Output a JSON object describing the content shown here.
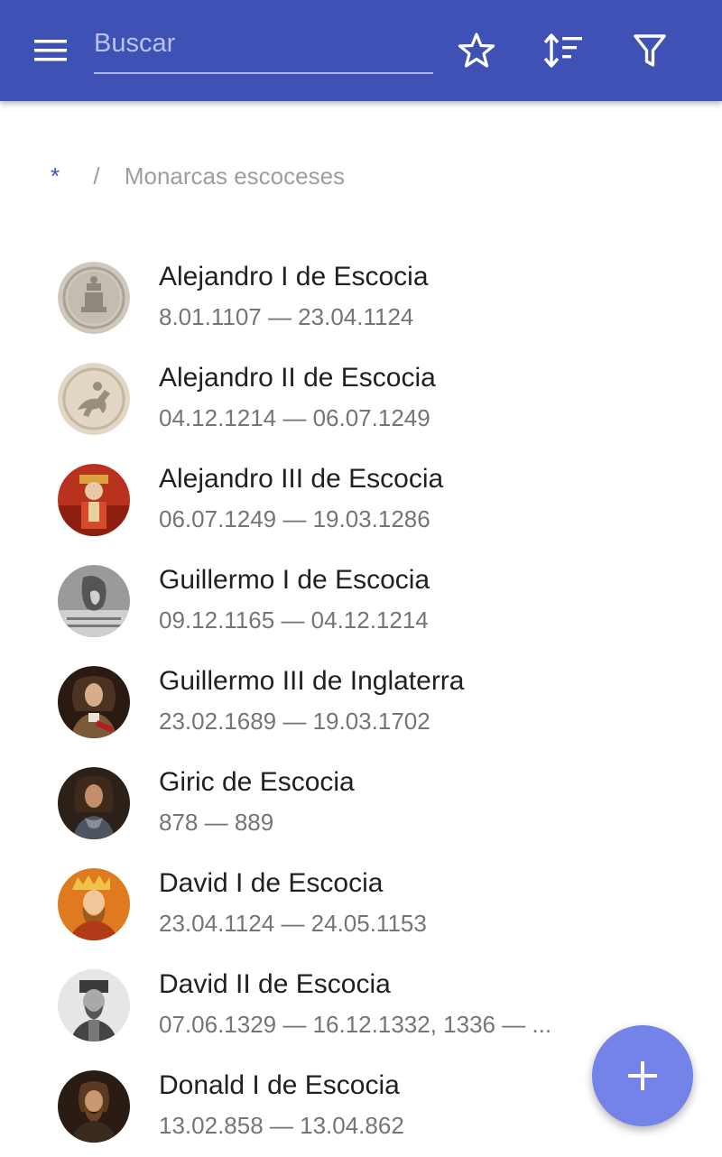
{
  "appbar": {
    "search_placeholder": "Buscar",
    "icons": [
      "menu-icon",
      "star-icon",
      "sort-icon",
      "filter-icon"
    ],
    "accent_color": "#3f51b5"
  },
  "breadcrumb": {
    "root": "*",
    "separator": "/",
    "current": "Monarcas escoceses"
  },
  "items": [
    {
      "name": "Alejandro I de Escocia",
      "dates": "8.01.1107 — 23.04.1124"
    },
    {
      "name": "Alejandro II de Escocia",
      "dates": "04.12.1214 — 06.07.1249"
    },
    {
      "name": "Alejandro III de Escocia",
      "dates": "06.07.1249 — 19.03.1286"
    },
    {
      "name": "Guillermo I de Escocia",
      "dates": "09.12.1165 — 04.12.1214"
    },
    {
      "name": "Guillermo III de Inglaterra",
      "dates": "23.02.1689 — 19.03.1702"
    },
    {
      "name": "Giric de Escocia",
      "dates": "878 — 889"
    },
    {
      "name": "David I de Escocia",
      "dates": "23.04.1124 — 24.05.1153"
    },
    {
      "name": "David II de Escocia",
      "dates": "07.06.1329 — 16.12.1332, 1336 — ..."
    },
    {
      "name": "Donald I de Escocia",
      "dates": "13.02.858 — 13.04.862"
    }
  ],
  "fab": {
    "icon": "plus-icon",
    "color": "#7383e8"
  }
}
